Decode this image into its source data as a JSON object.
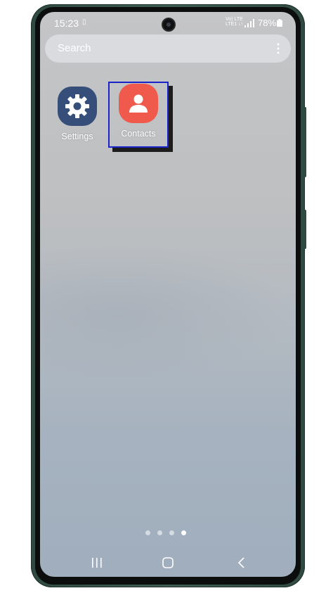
{
  "status_bar": {
    "time": "15:23",
    "network_line1": "Vo) LTE",
    "network_line2": "LTE1 ↓↑",
    "battery": "78%"
  },
  "search": {
    "placeholder": "Search"
  },
  "apps": [
    {
      "label": "Settings",
      "icon": "gear-icon",
      "color": "#354f7a"
    },
    {
      "label": "Contacts",
      "icon": "person-icon",
      "color": "#f05a4c"
    }
  ],
  "highlight_color": "#1a22c9",
  "pages": {
    "count": 4,
    "current": 4
  },
  "nav": {
    "recents": "recents-icon",
    "home": "home-icon",
    "back": "back-icon"
  }
}
